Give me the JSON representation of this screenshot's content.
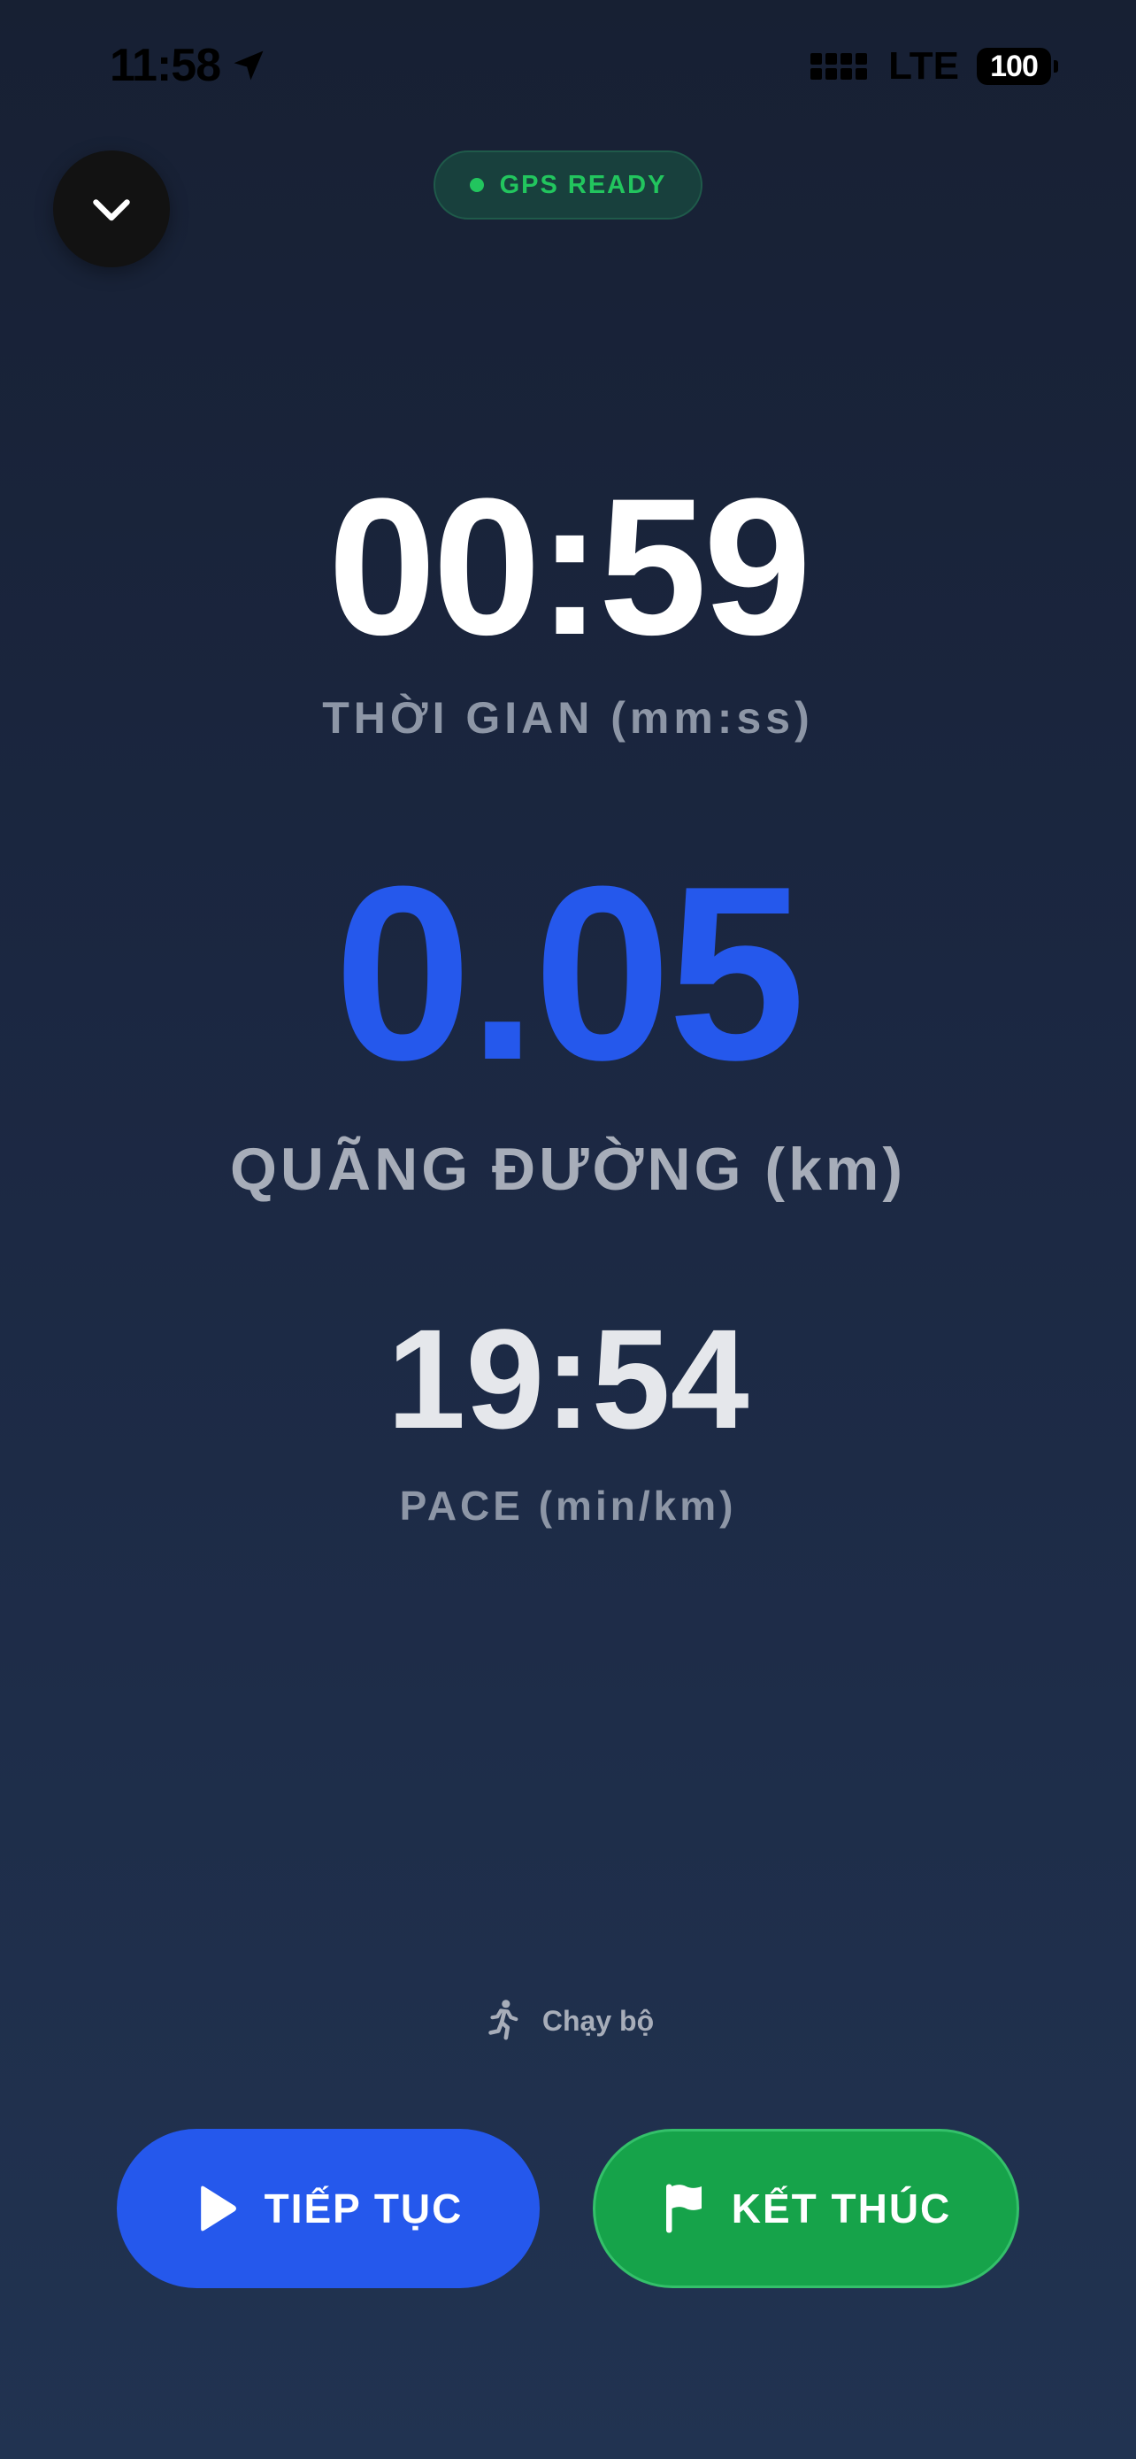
{
  "status_bar": {
    "time": "11:58",
    "carrier": "LTE",
    "battery": "100"
  },
  "gps": {
    "status": "GPS READY",
    "color": "#22c55e"
  },
  "metrics": {
    "time": {
      "value": "00:59",
      "label": "THỜI GIAN (mm:ss)"
    },
    "distance": {
      "value": "0.05",
      "label": "QUÃNG ĐƯỜNG (km)",
      "color": "#2558ec"
    },
    "pace": {
      "value": "19:54",
      "label": "PACE (min/km)"
    }
  },
  "activity": {
    "icon": "running-icon",
    "label": "Chạy bộ"
  },
  "actions": {
    "resume": {
      "label": "TIẾP TỤC",
      "icon": "play-icon",
      "color": "#2558ec"
    },
    "finish": {
      "label": "KẾT THÚC",
      "icon": "flag-icon",
      "color": "#16a34a"
    }
  }
}
